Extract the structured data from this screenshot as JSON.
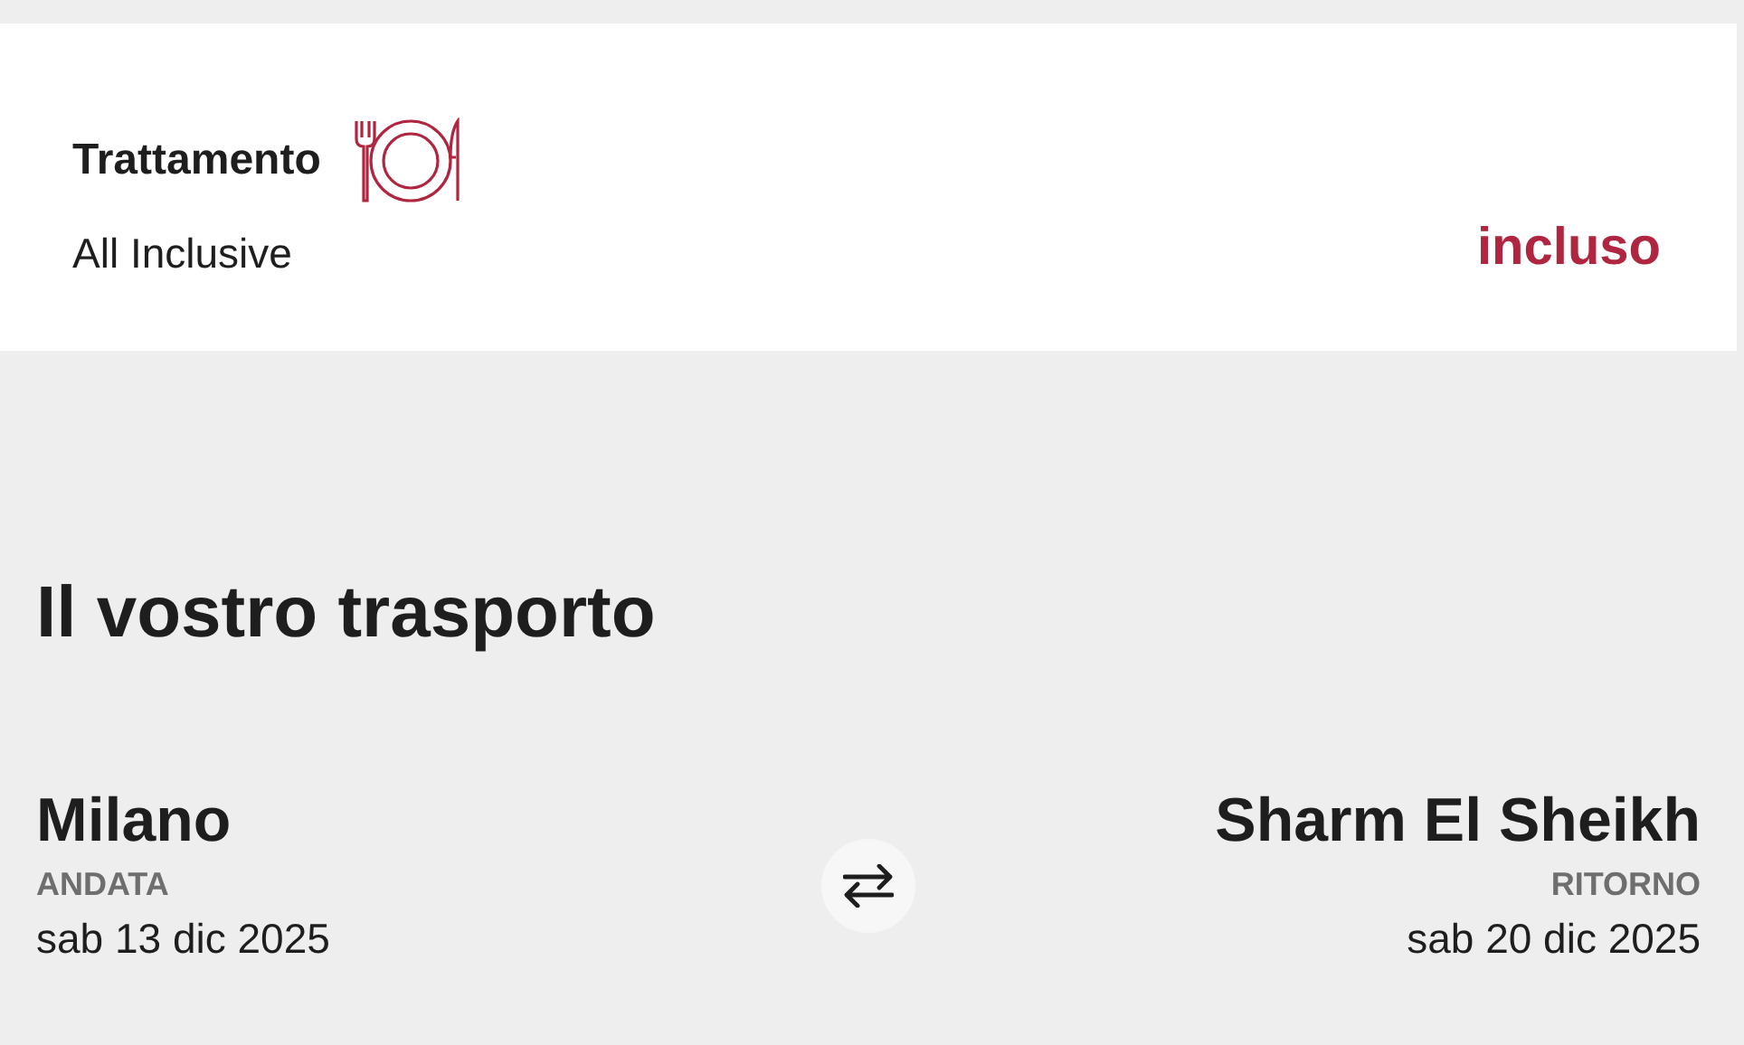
{
  "board": {
    "title": "Trattamento",
    "name": "All Inclusive",
    "price": "incluso"
  },
  "transport": {
    "title": "Il vostro trasporto",
    "legs": [
      {
        "city": "Milano",
        "label": "ANDATA",
        "date": "sab 13 dic 2025"
      },
      {
        "city": "Sharm El Sheikh",
        "label": "RITORNO",
        "date": "sab 20 dic 2025"
      }
    ]
  }
}
